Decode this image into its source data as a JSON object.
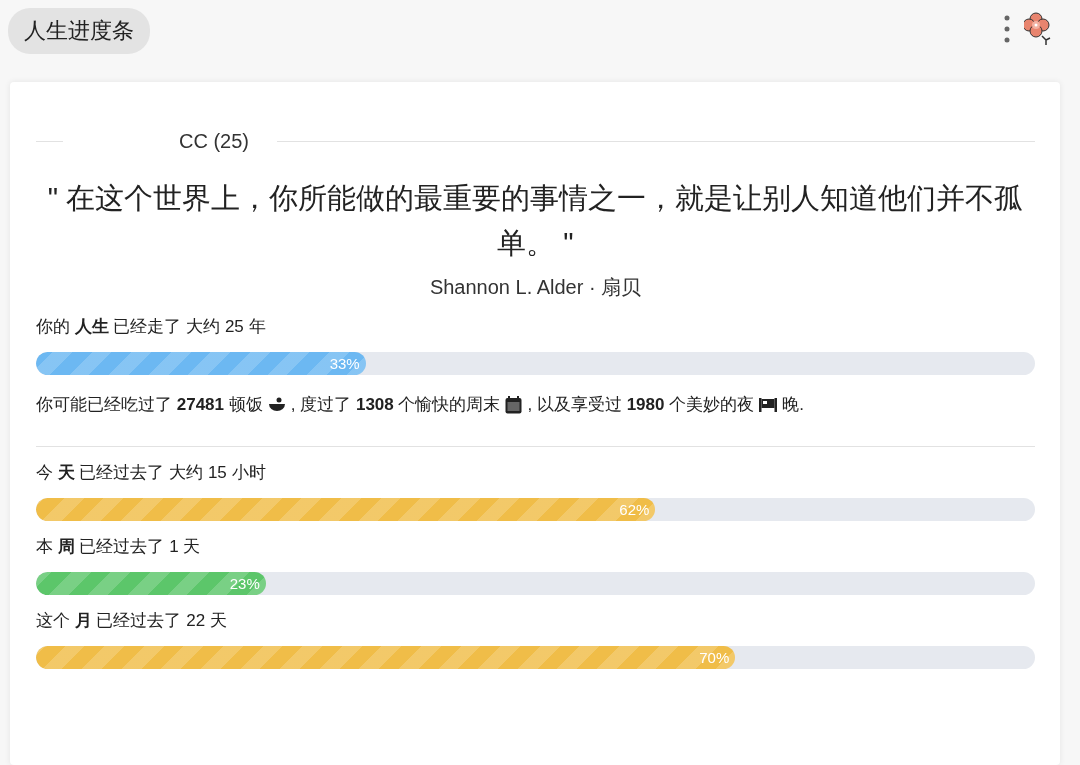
{
  "header": {
    "title": "人生进度条"
  },
  "card": {
    "name": "CC (25)",
    "quote": "\" 在这个世界上，你所能做的最重要的事情之一，就是让别人知道他们并不孤单。 \"",
    "author": "Shannon L. Alder · 扇贝",
    "life": {
      "label": "你的 **人生** 已经走了 大约 25 年",
      "level": 0.33,
      "percent": "33%",
      "color": "#6cb8f2"
    },
    "stats": [
      {
        "kind": "text",
        "text": "你可能已经吃过了 **27481** 顿饭"
      },
      {
        "kind": "meal"
      },
      {
        "kind": "text",
        "text": ", 度过了 **1308** 个愉快的周末"
      },
      {
        "kind": "calendar"
      },
      {
        "kind": "text",
        "text": ", 以及享受过 **1980** 个美妙的夜"
      },
      {
        "kind": "bed"
      },
      {
        "kind": "text",
        "text": "晚."
      }
    ],
    "bars": [
      {
        "label": "今 **天** 已经过去了 大约 15 小时",
        "level": 0.62,
        "percent": "62%",
        "color": "#f0bd48"
      },
      {
        "label": "本 **周** 已经过去了 1 天",
        "level": 0.23,
        "percent": "23%",
        "color": "#5cc66a"
      },
      {
        "label": "这个 **月** 已经过去了 22 天",
        "level": 0.7,
        "percent": "70%",
        "color": "#f0bd48"
      }
    ]
  }
}
